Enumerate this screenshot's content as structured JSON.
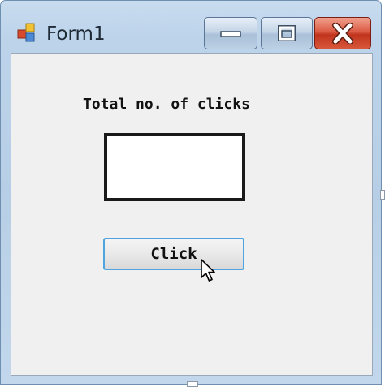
{
  "window": {
    "title": "Form1"
  },
  "titlebar": {
    "app_icon": "form-app-icon",
    "minimize_icon": "minimize-icon",
    "maximize_icon": "maximize-icon",
    "close_icon": "close-icon"
  },
  "form": {
    "label_text": "Total no. of clicks",
    "textbox_value": "",
    "button_label": "Click"
  },
  "colors": {
    "close_button": "#c8402a",
    "button_focus_border": "#4fa3e0",
    "client_background": "#f0f0f0"
  }
}
